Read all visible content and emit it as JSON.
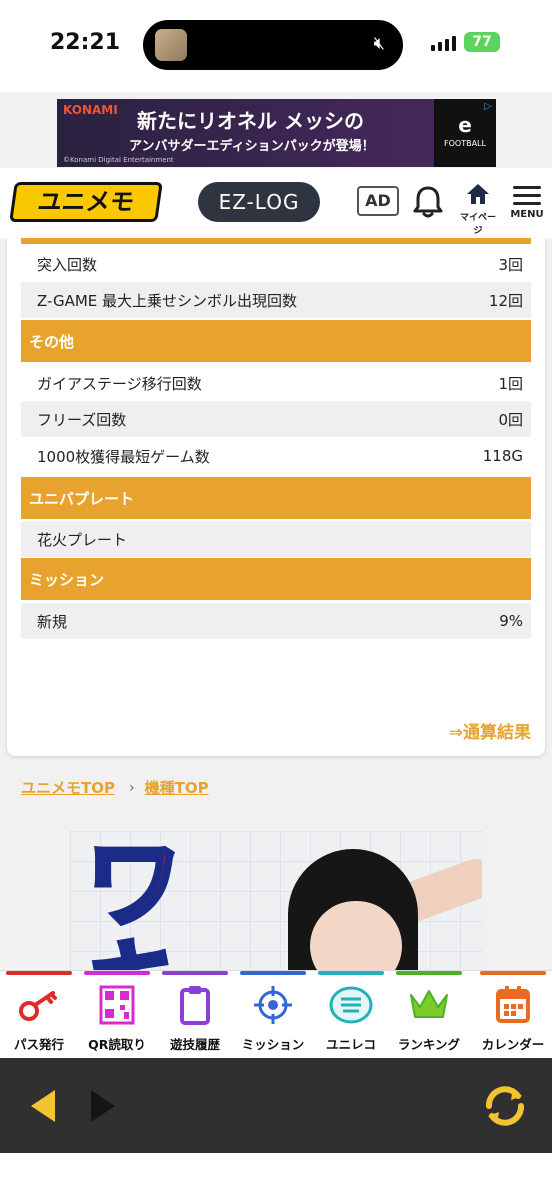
{
  "status_bar": {
    "time": "22:21",
    "battery": "77"
  },
  "ad_banner": {
    "brand": "KONAMI",
    "line1": "新たにリオネル メッシの",
    "line2": "アンバサダーエディションパックが登場！",
    "credit": "©Konami Digital Entertainment",
    "side_title": "e",
    "side_text": "FOOTBALL"
  },
  "header": {
    "logo": "ユニメモ",
    "ezlog": "EZ-LOG",
    "ad_button": "AD",
    "mypage_label": "マイページ",
    "menu_label": "MENU"
  },
  "stats": {
    "rows_top": [
      {
        "label": "突入回数",
        "value": "3回"
      },
      {
        "label": "Z-GAME 最大上乗せシンボル出現回数",
        "value": "12回"
      }
    ],
    "section_other": "その他",
    "rows_other": [
      {
        "label": "ガイアステージ移行回数",
        "value": "1回"
      },
      {
        "label": "フリーズ回数",
        "value": "0回"
      },
      {
        "label": "1000枚獲得最短ゲーム数",
        "value": "118G"
      }
    ],
    "section_plate": "ユニバプレート",
    "rows_plate": [
      {
        "label": "花火プレート",
        "value": ""
      }
    ],
    "section_mission": "ミッション",
    "rows_mission": [
      {
        "label": "新規",
        "value": "9%"
      }
    ],
    "total_link": "⇒通算結果"
  },
  "breadcrumb": {
    "home": "ユニメモTOP",
    "separator": "›",
    "model": "機種TOP"
  },
  "promo": {
    "kana": "ワキ"
  },
  "tabbar": {
    "items": [
      {
        "label": "パス発行",
        "color": "#e02a2a"
      },
      {
        "label": "QR読取り",
        "color": "#d62ccf"
      },
      {
        "label": "遊技履歴",
        "color": "#8a3fd6"
      },
      {
        "label": "ミッション",
        "color": "#3566d8"
      },
      {
        "label": "ユニレコ",
        "color": "#1fb3b8"
      },
      {
        "label": "ランキング",
        "color": "#4db026"
      },
      {
        "label": "カレンダー",
        "color": "#ec6a1f"
      }
    ]
  },
  "colors": {
    "accent": "#e8a32e",
    "browser_bar": "#303030",
    "nav_arrow": "#f4c430"
  }
}
